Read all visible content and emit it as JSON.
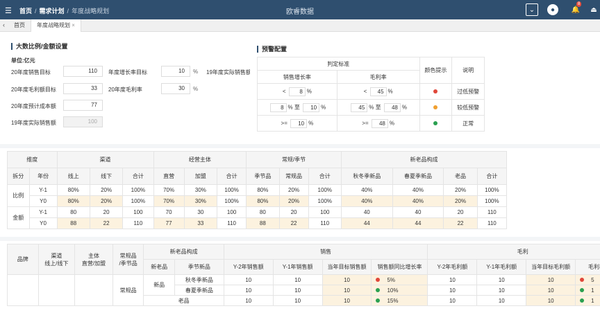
{
  "topbar": {
    "crumbs": [
      "首页",
      "需求计划",
      "年度战略规划"
    ],
    "app_title": "欧睿数据",
    "badge": "8"
  },
  "tabs": [
    "首页",
    "年度战略规划"
  ],
  "settings": {
    "title": "大数比例/金额设置",
    "unit": "单位:亿元",
    "sales_target": {
      "label": "20年度销售目标",
      "value": "110"
    },
    "gross_target": {
      "label": "20年度毛利额目标",
      "value": "33"
    },
    "cost_target": {
      "label": "20年度预计成本额",
      "value": "77"
    },
    "actual_sales": {
      "label": "19年度实际销售额",
      "value": "100"
    },
    "growth_target": {
      "label": "年度增长率目标",
      "value": "10",
      "unit": "%"
    },
    "gross_rate": {
      "label": "20年度毛利率",
      "value": "30",
      "unit": "%"
    },
    "actual_sales_2": {
      "label": "19年度实际销售额"
    }
  },
  "warning": {
    "title": "预警配置",
    "headers": {
      "criteria": "判定标准",
      "color": "颜色提示",
      "desc": "说明",
      "growth": "销售增长率",
      "margin": "毛利率",
      "to": "至",
      "pct": "%"
    },
    "rows": [
      {
        "g_op": "<",
        "g_v": "8",
        "m_op": "<",
        "m_v": "45",
        "color": "#e0473a",
        "desc": "过低预警"
      },
      {
        "g_a": "8",
        "g_b": "10",
        "m_a": "45",
        "m_b": "48",
        "color": "#f0a030",
        "desc": "较低预警"
      },
      {
        "g_op": ">=",
        "g_v": "10",
        "m_op": ">=",
        "m_v": "48",
        "color": "#2aa050",
        "desc": "正常"
      }
    ]
  },
  "t1": {
    "head1": [
      "维度",
      "渠道",
      "经营主体",
      "常规/季节",
      "新老品构成"
    ],
    "head2": [
      "拆分",
      "年份",
      "线上",
      "线下",
      "合计",
      "直营",
      "加盟",
      "合计",
      "季节品",
      "常规品",
      "合计",
      "秋冬季新品",
      "春夏季新品",
      "老品",
      "合计"
    ],
    "groups": [
      {
        "name": "比例",
        "rows": [
          {
            "year": "Y-1",
            "vals": [
              "80%",
              "20%",
              "100%",
              "70%",
              "30%",
              "100%",
              "80%",
              "20%",
              "100%",
              "40%",
              "40%",
              "20%",
              "100%"
            ],
            "tint": false
          },
          {
            "year": "Y0",
            "vals": [
              "80%",
              "20%",
              "100%",
              "70%",
              "30%",
              "100%",
              "80%",
              "20%",
              "100%",
              "40%",
              "40%",
              "20%",
              "100%"
            ],
            "tint": true
          }
        ]
      },
      {
        "name": "金额",
        "rows": [
          {
            "year": "Y-1",
            "vals": [
              "80",
              "20",
              "100",
              "70",
              "30",
              "100",
              "80",
              "20",
              "100",
              "40",
              "40",
              "20",
              "110"
            ],
            "tint": false
          },
          {
            "year": "Y0",
            "vals": [
              "88",
              "22",
              "110",
              "77",
              "33",
              "110",
              "88",
              "22",
              "110",
              "44",
              "44",
              "22",
              "110"
            ],
            "tint": true
          }
        ]
      }
    ]
  },
  "t2": {
    "head1": {
      "brand": "品牌",
      "channel": "渠道\n线上/线下",
      "subject": "主体\n直营/加盟",
      "regular": "常规品\n/季节品",
      "mix": "新老品构成",
      "sales": "销售",
      "gross": "毛利"
    },
    "head2": [
      "新老品",
      "季节新品",
      "Y-2年销售额",
      "Y-1年销售额",
      "当年目标销售额",
      "销售额同比增长率",
      "Y-2年毛利额",
      "Y-1年毛利额",
      "当年目标毛利额",
      "毛利率"
    ],
    "regular_label": "常规品",
    "new_label": "新品",
    "rows": [
      {
        "sub": "秋冬季新品",
        "vals": [
          "10",
          "10",
          "10",
          "5%",
          "10",
          "10",
          "10",
          "5"
        ],
        "dot": "#e0473a"
      },
      {
        "sub": "春夏季新品",
        "vals": [
          "10",
          "10",
          "10",
          "10%",
          "10",
          "10",
          "10",
          "1"
        ],
        "dot": "#2aa050"
      },
      {
        "sub": "老品",
        "vals": [
          "10",
          "10",
          "10",
          "15%",
          "10",
          "10",
          "10",
          "1"
        ],
        "dot": "#2aa050"
      }
    ]
  }
}
